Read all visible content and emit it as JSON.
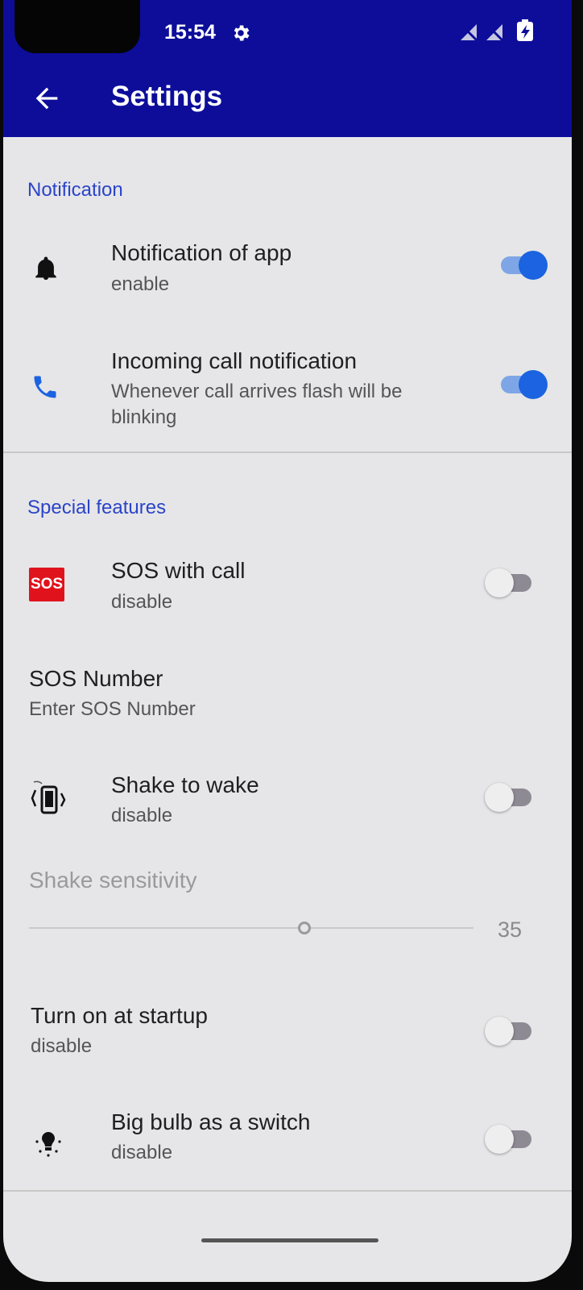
{
  "status_bar": {
    "time": "15:54",
    "icons": [
      "gear-icon",
      "no-signal-icon",
      "no-signal-icon",
      "battery-charging-icon"
    ]
  },
  "app_bar": {
    "title": "Settings",
    "back_icon": "arrow-left-icon",
    "background_color": "#0d0d9a"
  },
  "sections": {
    "notification": {
      "header": "Notification",
      "items": {
        "app_notification": {
          "title": "Notification of app",
          "subtitle": "enable",
          "icon": "bell-icon",
          "on": true
        },
        "incoming_call": {
          "title": "Incoming call notification",
          "subtitle": "Whenever call arrives flash will be blinking",
          "icon": "phone-icon",
          "on": true
        }
      }
    },
    "special": {
      "header": "Special features",
      "items": {
        "sos_call": {
          "title": "SOS with call",
          "subtitle": "disable",
          "icon": "sos-icon",
          "icon_text": "SOS",
          "on": false
        },
        "sos_number": {
          "title": "SOS Number",
          "subtitle": "Enter SOS Number"
        },
        "shake_wake": {
          "title": "Shake to wake",
          "subtitle": "disable",
          "icon": "shake-phone-icon",
          "on": false
        },
        "shake_sensitivity": {
          "title": "Shake sensitivity",
          "value": "35",
          "fraction": 0.62
        },
        "startup": {
          "title": "Turn on at startup",
          "subtitle": "disable",
          "on": false
        },
        "big_bulb": {
          "title": "Big bulb as a switch",
          "subtitle": "disable",
          "icon": "bulb-icon",
          "on": false
        }
      }
    }
  },
  "colors": {
    "accent": "#2b44c8",
    "switch_on": "#1b63e0",
    "sos_red": "#e0131c"
  }
}
